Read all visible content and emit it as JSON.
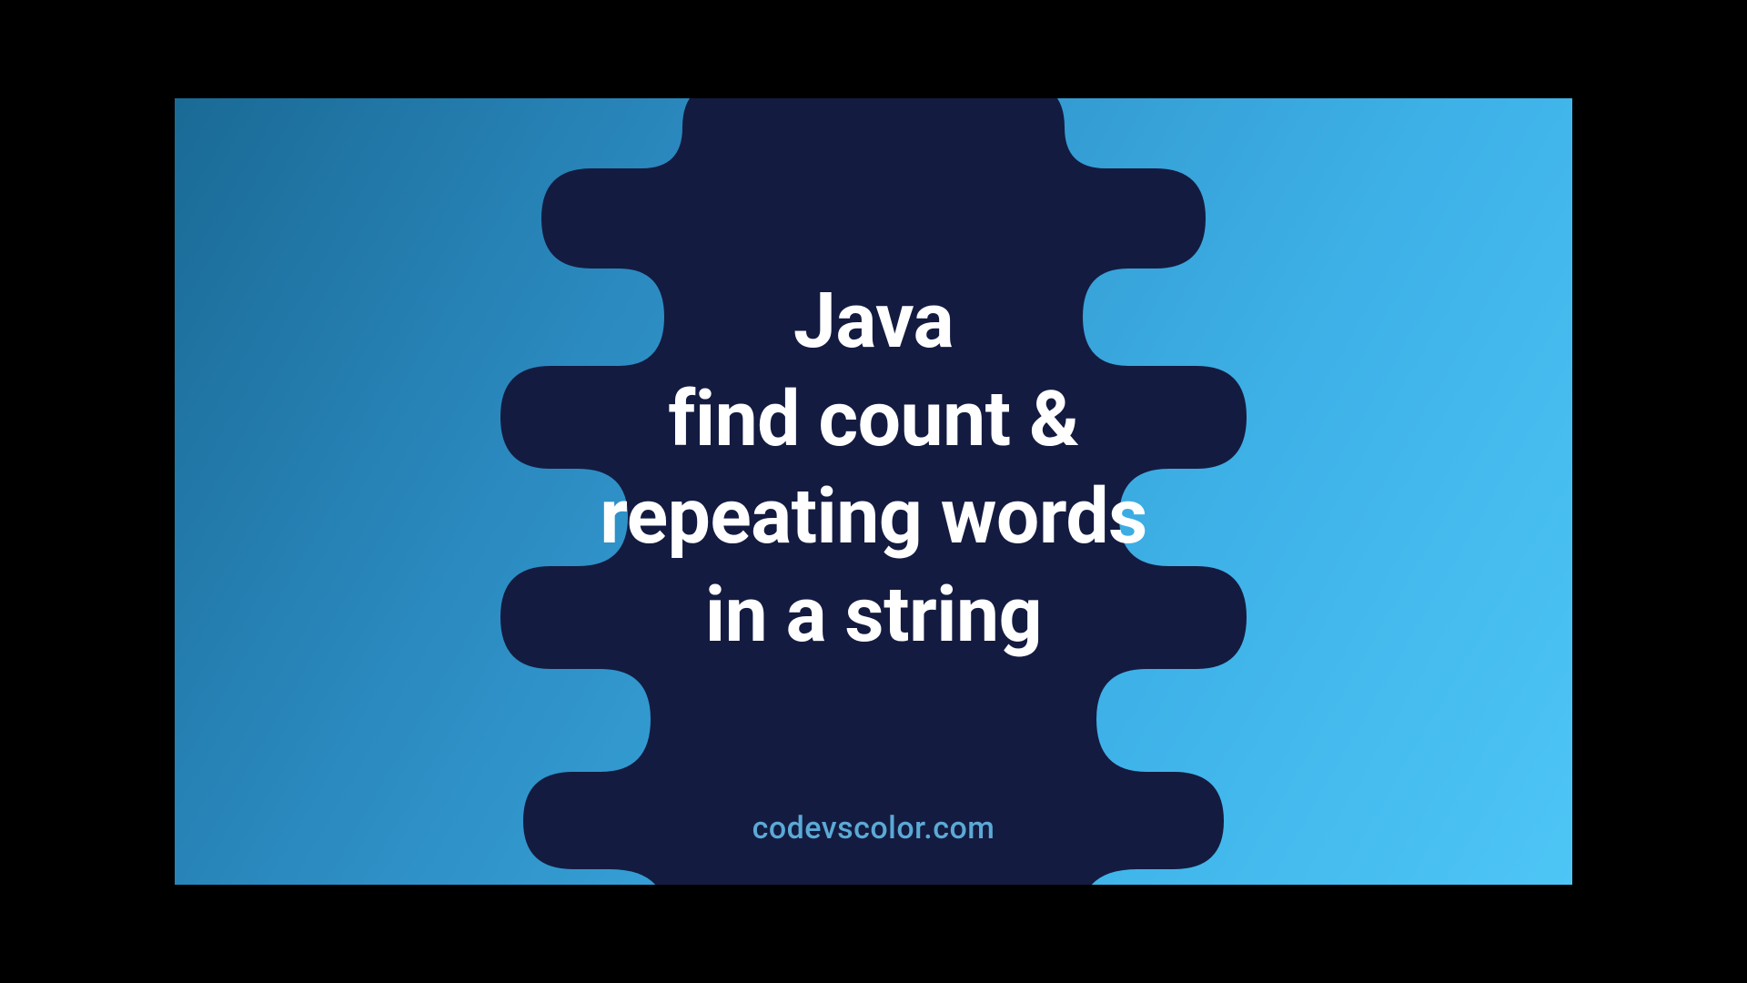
{
  "title": {
    "line1": "Java",
    "line2": "find count &",
    "line3": "repeating words",
    "line4": "in a string"
  },
  "watermark": "codevscolor.com",
  "colors": {
    "blob": "#141b41",
    "text": "#ffffff",
    "watermark": "#5ba9d6",
    "bg_gradient_start": "#1a6a95",
    "bg_gradient_end": "#4dc5f5"
  }
}
